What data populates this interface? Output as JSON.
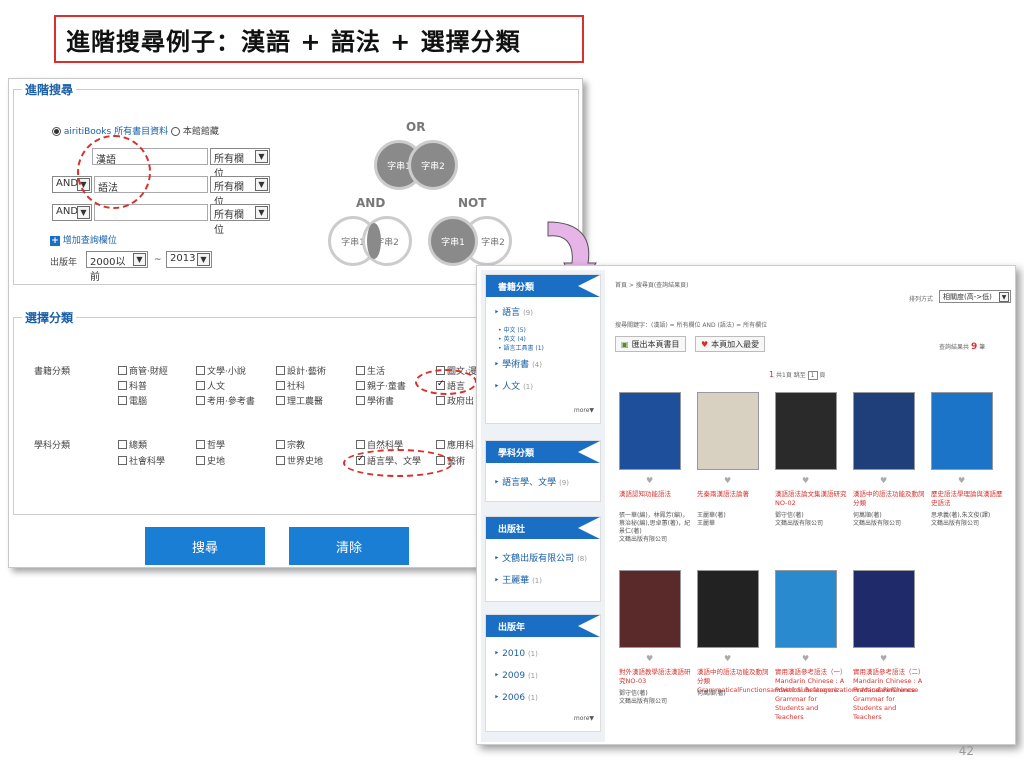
{
  "slide": {
    "title": "進階搜尋例子：漢語 + 語法 + 選擇分類",
    "page_number": "42"
  },
  "search": {
    "legend": "進階搜尋",
    "scope_option_1": "airitiBooks 所有書目資料",
    "scope_option_2": "本館館藏",
    "row1_value": "漢語",
    "row1_field": "所有欄位",
    "row2_operator": "AND",
    "row2_value": "語法",
    "row2_field": "所有欄位",
    "row3_operator": "AND",
    "row3_value": "",
    "row3_field": "所有欄位",
    "add_field": "增加查詢欄位",
    "year_label": "出版年",
    "year_from": "2000以前",
    "year_sep": "~",
    "year_to": "2013"
  },
  "venn": {
    "or_label": "OR",
    "and_label": "AND",
    "not_label": "NOT",
    "term1": "字串1",
    "term2": "字串2"
  },
  "categories": {
    "legend": "選擇分類",
    "book_label": "書籍分類",
    "book_items": [
      "商管·財經",
      "文學·小說",
      "設計·藝術",
      "生活",
      "圖文·漫",
      "科普",
      "人文",
      "社科",
      "親子·童書",
      "語言",
      "電腦",
      "考用·參考書",
      "理工農醫",
      "學術書",
      "政府出"
    ],
    "subject_label": "學科分類",
    "subject_items": [
      "總類",
      "哲學",
      "宗教",
      "自然科學",
      "應用科",
      "社會科學",
      "史地",
      "世界史地",
      "語言學、文學",
      "藝術"
    ]
  },
  "buttons": {
    "search": "搜尋",
    "clear": "清除"
  },
  "results": {
    "breadcrumb": "首頁 > 搜尋頁(查詢結果頁)",
    "sort_label": "排列方式",
    "sort_value": "相關度(高->低)",
    "query_text": "搜尋關鍵字：(漢語) = 所有欄位 AND (語法) = 所有欄位",
    "export_btn": "匯出本頁書目",
    "fav_btn": "本頁加入最愛",
    "count_text": "查詢結果共",
    "count_num": "9",
    "count_unit": "筆",
    "pager": "1",
    "pager_rest": "共1頁 跳至",
    "pager_select": "1",
    "pager_page": "頁"
  },
  "sidebar": {
    "book_head": "書籍分類",
    "lang": "語言",
    "lang_cnt": "(9)",
    "sub1": "• 中文 (5)",
    "sub2": "• 英文 (4)",
    "sub3": "• 語言工具書 (1)",
    "academic": "學術書",
    "academic_cnt": "(4)",
    "humanities": "人文",
    "humanities_cnt": "(1)",
    "more": "more▼",
    "subject_head": "學科分類",
    "subject_item": "語言學、文學",
    "subject_cnt": "(9)",
    "pub_head": "出版社",
    "pub1": "文鶴出版有限公司",
    "pub1_cnt": "(8)",
    "pub2": "王麗華",
    "pub2_cnt": "(1)",
    "year_head": "出版年",
    "y1": "2010",
    "y1_cnt": "(1)",
    "y2": "2009",
    "y2_cnt": "(1)",
    "y3": "2006",
    "y3_cnt": "(1)",
    "more2": "more▼"
  },
  "books": [
    {
      "title": "漢語認知功能語法",
      "meta": "張一華(編)，林鳳芳(編)，蔡治秘(編),思卓蕙(著)，紀景仁(著)\n文鶴出版有限公司",
      "color": "#1d4f9a"
    },
    {
      "title": "先秦兩漢語法論著",
      "meta": "王麗華(著)\n王麗華",
      "color": "#d8d0c0"
    },
    {
      "title": "漢語語法論文集漢語研究NO-02",
      "meta": "鄧守信(著)\n文鶴出版有限公司",
      "color": "#2a2a2a"
    },
    {
      "title": "漢語中的語法功能及動詞分類",
      "meta": "何萬順(著)\n文鶴出版有限公司",
      "color": "#1f3f7a"
    },
    {
      "title": "歷史語法學理論與漢語歷史語法",
      "meta": "思承義(著),朱文俊(譯)\n文鶴出版有限公司",
      "color": "#1c74c8"
    },
    {
      "title": "對外漢語教學語法漢語研究NO-03",
      "meta": "鄧守信(著)\n文鶴出版有限公司",
      "color": "#5a2a2a"
    },
    {
      "title": "漢語中的語法功能及動詞分類GrammaticalFunctionsandVerbSubcategorizationinMandarinChinese",
      "meta": "何萬順(著)",
      "color": "#222"
    },
    {
      "title": "實用漢語參考語法（一）Mandarin Chinese : A Practical Reference Grammar for Students and Teachers",
      "meta": "",
      "color": "#2a8ad0"
    },
    {
      "title": "實用漢語參考語法（二）Mandarin Chinese : A Practical Reference Grammar for Students and Teachers",
      "meta": "",
      "color": "#1f2a6a"
    }
  ]
}
